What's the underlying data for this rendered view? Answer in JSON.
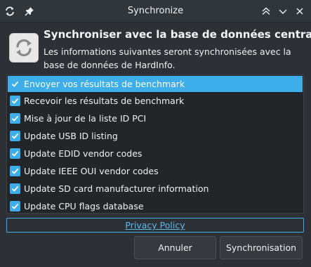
{
  "window": {
    "title": "Synchronize",
    "icons": [
      "sync-icon",
      "pin-icon",
      "keep-above-icon",
      "minimize-icon",
      "close-icon"
    ]
  },
  "header": {
    "title": "Synchroniser avec la base de données centrale",
    "subtitle": "Les informations suivantes seront synchronisées avec la base de données de HardInfo."
  },
  "items": [
    {
      "label": "Envoyer vos résultats de benchmark",
      "checked": true,
      "selected": true
    },
    {
      "label": "Recevoir les résultats de benchmark",
      "checked": true,
      "selected": false
    },
    {
      "label": "Mise à jour de la liste ID PCI",
      "checked": true,
      "selected": false
    },
    {
      "label": "Update USB ID listing",
      "checked": true,
      "selected": false
    },
    {
      "label": "Update EDID vendor codes",
      "checked": true,
      "selected": false
    },
    {
      "label": "Update IEEE OUI vendor codes",
      "checked": true,
      "selected": false
    },
    {
      "label": "Update SD card manufacturer information",
      "checked": true,
      "selected": false
    },
    {
      "label": "Update CPU flags database",
      "checked": true,
      "selected": false
    }
  ],
  "privacy_link": "Privacy Policy",
  "buttons": {
    "cancel": "Annuler",
    "sync": "Synchronisation"
  },
  "colors": {
    "accent": "#3daee9",
    "background": "#2d3035",
    "list_background": "#232629"
  }
}
